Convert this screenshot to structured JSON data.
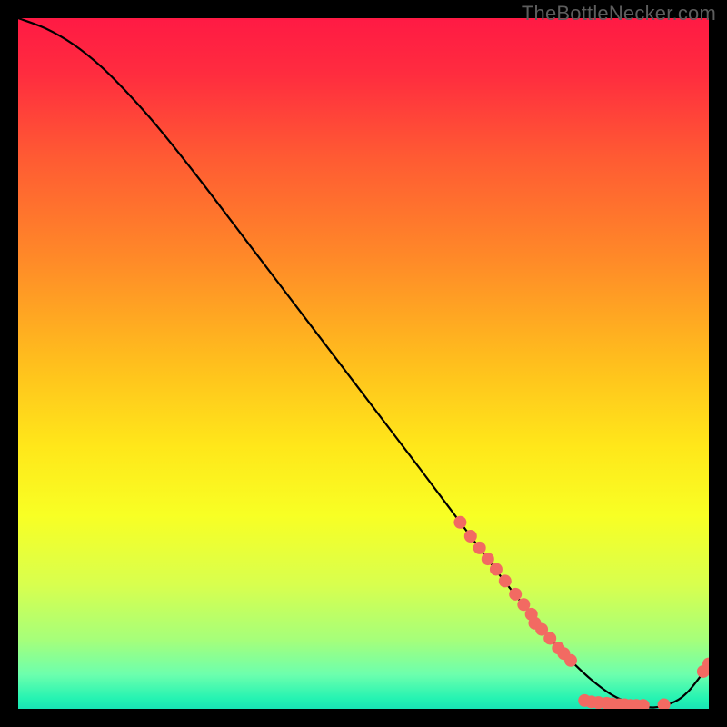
{
  "watermark": "TheBottleNecker.com",
  "chart_data": {
    "type": "line",
    "title": "",
    "xlabel": "",
    "ylabel": "",
    "xlim": [
      0,
      100
    ],
    "ylim": [
      0,
      100
    ],
    "background_gradient": {
      "stops": [
        {
          "offset": 0.0,
          "color": "#ff1a44"
        },
        {
          "offset": 0.08,
          "color": "#ff2c3f"
        },
        {
          "offset": 0.2,
          "color": "#ff5a33"
        },
        {
          "offset": 0.35,
          "color": "#ff8a28"
        },
        {
          "offset": 0.5,
          "color": "#ffbf1d"
        },
        {
          "offset": 0.62,
          "color": "#ffe71a"
        },
        {
          "offset": 0.72,
          "color": "#f8ff24"
        },
        {
          "offset": 0.82,
          "color": "#d8ff4e"
        },
        {
          "offset": 0.9,
          "color": "#a6ff7a"
        },
        {
          "offset": 0.95,
          "color": "#6dffad"
        },
        {
          "offset": 0.985,
          "color": "#25f3b2"
        },
        {
          "offset": 1.0,
          "color": "#18e3b4"
        }
      ]
    },
    "series": [
      {
        "name": "curve",
        "x": [
          0,
          4,
          8,
          12,
          16,
          20,
          26,
          34,
          42,
          50,
          58,
          64,
          70,
          74,
          77,
          80,
          83,
          86,
          89,
          92,
          95,
          97,
          99,
          100
        ],
        "y": [
          100,
          98.5,
          96.2,
          93.0,
          89.0,
          84.5,
          77.0,
          66.5,
          56.0,
          45.5,
          35.0,
          27.0,
          19.0,
          14.0,
          10.2,
          7.0,
          4.2,
          2.0,
          0.7,
          0.2,
          1.0,
          2.5,
          5.0,
          6.5
        ]
      }
    ],
    "markers": {
      "name": "dots",
      "color": "#f26a62",
      "points": [
        {
          "x": 64.0,
          "y": 27.0
        },
        {
          "x": 65.5,
          "y": 25.0
        },
        {
          "x": 66.8,
          "y": 23.3
        },
        {
          "x": 68.0,
          "y": 21.7
        },
        {
          "x": 69.2,
          "y": 20.2
        },
        {
          "x": 70.5,
          "y": 18.5
        },
        {
          "x": 72.0,
          "y": 16.6
        },
        {
          "x": 73.2,
          "y": 15.1
        },
        {
          "x": 74.3,
          "y": 13.7
        },
        {
          "x": 74.8,
          "y": 12.4
        },
        {
          "x": 75.8,
          "y": 11.5
        },
        {
          "x": 77.0,
          "y": 10.2
        },
        {
          "x": 78.2,
          "y": 8.8
        },
        {
          "x": 79.0,
          "y": 8.0
        },
        {
          "x": 80.0,
          "y": 7.0
        },
        {
          "x": 82.0,
          "y": 1.2
        },
        {
          "x": 83.0,
          "y": 1.0
        },
        {
          "x": 84.0,
          "y": 0.9
        },
        {
          "x": 85.2,
          "y": 0.8
        },
        {
          "x": 86.0,
          "y": 0.7
        },
        {
          "x": 87.0,
          "y": 0.6
        },
        {
          "x": 87.8,
          "y": 0.6
        },
        {
          "x": 88.7,
          "y": 0.5
        },
        {
          "x": 89.5,
          "y": 0.5
        },
        {
          "x": 90.5,
          "y": 0.5
        },
        {
          "x": 93.5,
          "y": 0.6
        },
        {
          "x": 99.2,
          "y": 5.4
        },
        {
          "x": 100.0,
          "y": 6.5
        }
      ]
    }
  }
}
